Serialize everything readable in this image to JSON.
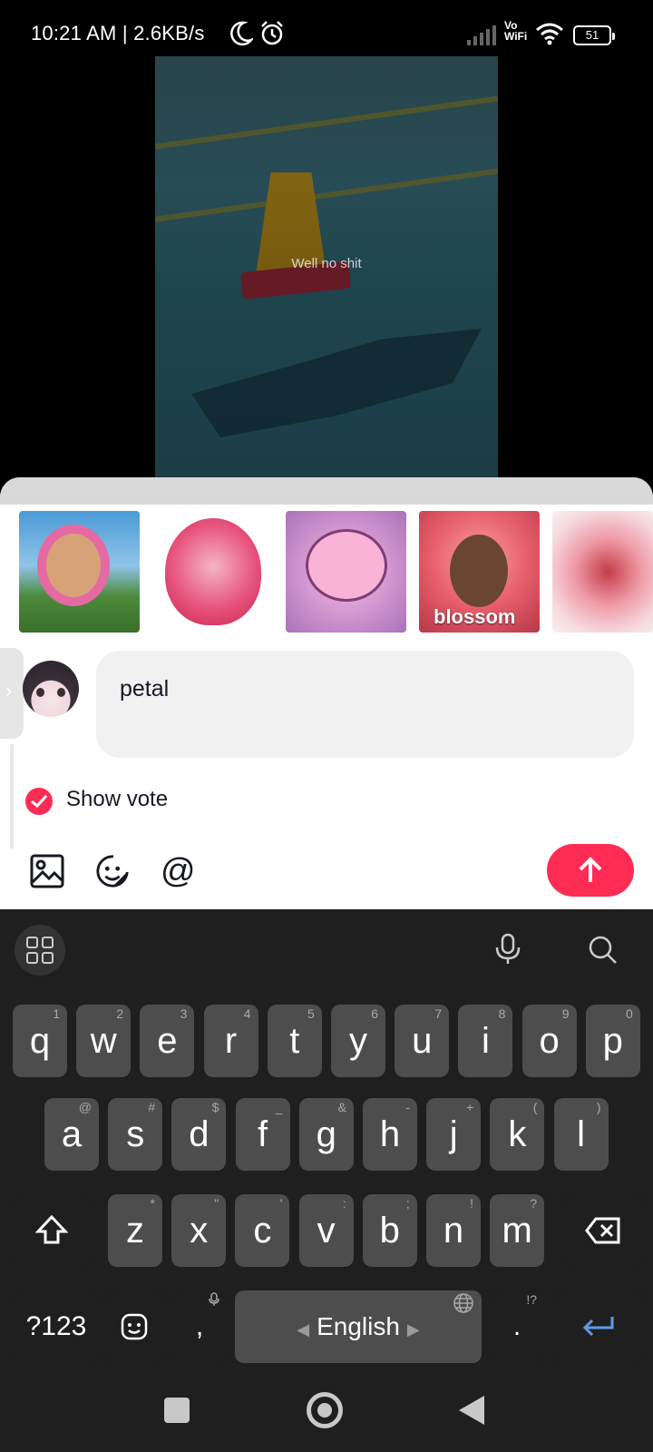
{
  "status_bar": {
    "time_speed": "10:21 AM | 2.6KB/s",
    "vowifi": "Vo\nWiFi",
    "battery": "51"
  },
  "video": {
    "caption": "Well no shit"
  },
  "stickers": [
    {
      "id": "sticker-1",
      "label": ""
    },
    {
      "id": "sticker-2",
      "label": ""
    },
    {
      "id": "sticker-3",
      "label": ""
    },
    {
      "id": "sticker-4",
      "label": "blossom"
    },
    {
      "id": "sticker-5",
      "label": ""
    }
  ],
  "comment": {
    "input_value": "petal"
  },
  "vote": {
    "label": "Show vote",
    "checked": true
  },
  "colors": {
    "accent": "#fe2c55",
    "keyboard_bg": "#1f1f1f",
    "key_bg": "#4d4d4d"
  },
  "keyboard": {
    "row1": [
      {
        "key": "q",
        "hint": "1"
      },
      {
        "key": "w",
        "hint": "2"
      },
      {
        "key": "e",
        "hint": "3"
      },
      {
        "key": "r",
        "hint": "4"
      },
      {
        "key": "t",
        "hint": "5"
      },
      {
        "key": "y",
        "hint": "6"
      },
      {
        "key": "u",
        "hint": "7"
      },
      {
        "key": "i",
        "hint": "8"
      },
      {
        "key": "o",
        "hint": "9"
      },
      {
        "key": "p",
        "hint": "0"
      }
    ],
    "row2": [
      {
        "key": "a",
        "hint": "@"
      },
      {
        "key": "s",
        "hint": "#"
      },
      {
        "key": "d",
        "hint": "$"
      },
      {
        "key": "f",
        "hint": "_"
      },
      {
        "key": "g",
        "hint": "&"
      },
      {
        "key": "h",
        "hint": "-"
      },
      {
        "key": "j",
        "hint": "+"
      },
      {
        "key": "k",
        "hint": "("
      },
      {
        "key": "l",
        "hint": ")"
      }
    ],
    "row3": [
      {
        "key": "z",
        "hint": "*"
      },
      {
        "key": "x",
        "hint": "\""
      },
      {
        "key": "c",
        "hint": "'"
      },
      {
        "key": "v",
        "hint": ":"
      },
      {
        "key": "b",
        "hint": ";"
      },
      {
        "key": "n",
        "hint": "!"
      },
      {
        "key": "m",
        "hint": "?"
      }
    ],
    "symbols_label": "?123",
    "comma": ",",
    "space_label": "English",
    "period": ".",
    "period_hint": "!?"
  }
}
